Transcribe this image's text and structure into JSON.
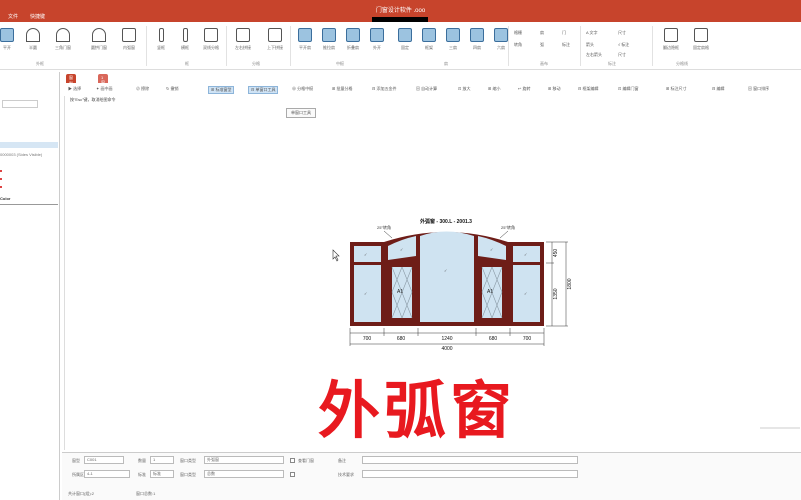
{
  "titlebar": {
    "title": "门窗设计软件 .ooo",
    "tabs": [
      "文件",
      "快捷键"
    ]
  },
  "ribbon": {
    "items": [
      "平开",
      "半圆",
      "三角门窗",
      "圆拱门窗",
      "内弧窗",
      "竖框",
      "横框",
      "双线分格",
      "左右拼接",
      "上下拼接",
      "平开扇",
      "推拉扇",
      "折叠扇",
      "外开",
      "固定",
      "框架",
      "三扇",
      "四扇",
      "六扇"
    ],
    "groups": [
      "外框",
      "框",
      "分格",
      "中梃",
      "扇",
      "画布",
      "标注",
      "分格线"
    ],
    "mini": [
      "格栅",
      "扇",
      "转角",
      "弧",
      "门",
      "标注",
      "A 文字",
      "尺寸",
      "箭头",
      "√ 标注",
      "左右箭头",
      "尺寸",
      "翻边隐框",
      "固定扇格"
    ]
  },
  "left_panel": {
    "items": [
      "0000003 (Sides Visible)",
      "Color"
    ]
  },
  "doc_tabs": [
    "窗型列表",
    "1 窗口"
  ],
  "toolbar": {
    "tools": [
      "▶ 选择",
      "✦ 画中画",
      "⊘ 擦除",
      "↻ 撤销",
      "⊞ 标准窗型",
      "⊟ 单窗口工具",
      "⊕ 分格中梃",
      "⊞ 批量分格",
      "⊟ 添加五金件",
      "⊠ 自动计算",
      "⊡ 放大",
      "⊞ 缩小",
      "↩ 旋转",
      "⊞ 移动",
      "⊟ 框架编辑",
      "⊡ 编辑门窗",
      "⊞ 标注尺寸",
      "⊟ 编辑",
      "⊠ 窗口排序"
    ]
  },
  "hint": "按\"Esc\"键，取消绘图命令",
  "tooltip": "单窗口工具",
  "drawing": {
    "title": "外弧窗 - 300.L - 2001.3",
    "corner_labels": [
      "25°转角",
      "25°转角"
    ],
    "sash_labels": [
      "A1",
      "A1"
    ],
    "widths": [
      "700",
      "680",
      "1240",
      "680",
      "700"
    ],
    "total_width": "4000",
    "heights": [
      "450",
      "1350"
    ],
    "total_height": "1800"
  },
  "overlay_caption": "外弧窗",
  "props": {
    "labels": [
      "窗型",
      "数量",
      "窗口类型",
      "所属区域",
      "标准",
      "窗口类型",
      "查看门窗",
      "备注",
      "技术要求"
    ],
    "values": [
      "C001",
      "1",
      "外弧窗",
      "4-1",
      "标准",
      "总数"
    ],
    "status": [
      "共计窗口(组):2",
      "窗口总数:1"
    ]
  },
  "colors": {
    "accent": "#c7442c",
    "frame": "#6e1d18",
    "glass": "#cfe3f1",
    "caption": "#e8191f"
  }
}
